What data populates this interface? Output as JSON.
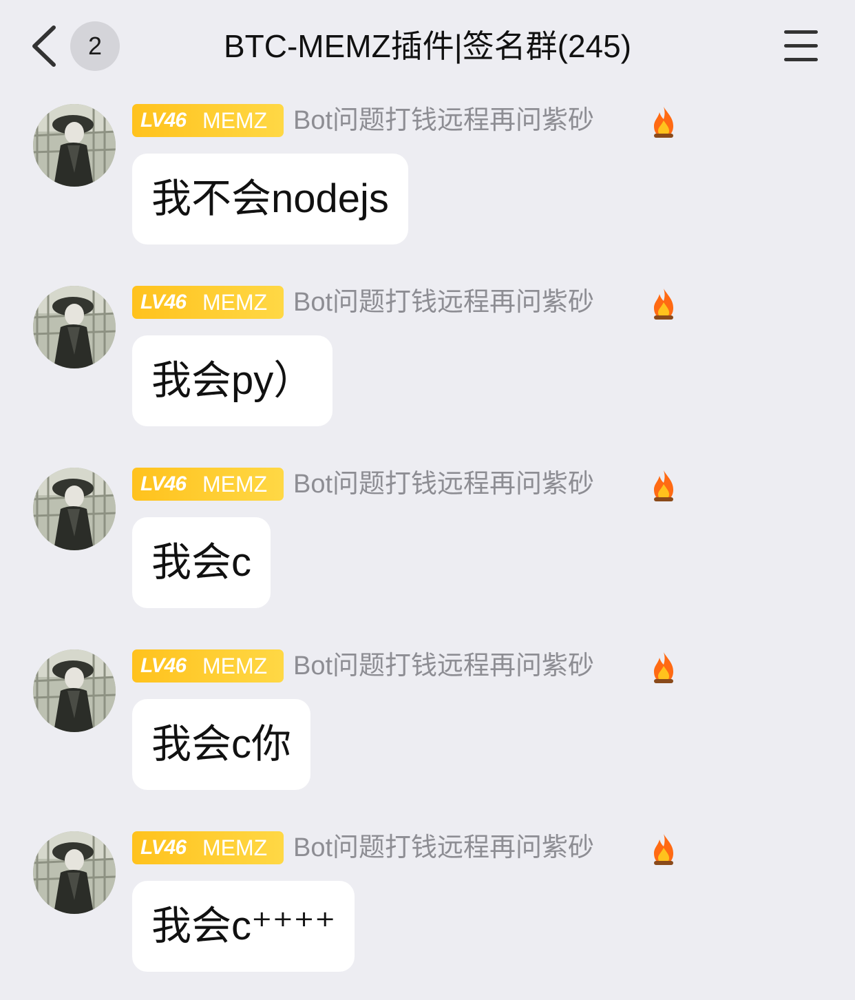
{
  "header": {
    "back_icon": "chevron-left-icon",
    "unread_count": "2",
    "title": "BTC-MEMZ插件|签名群(245)",
    "menu_icon": "hamburger-menu-icon"
  },
  "colors": {
    "background": "#ededf2",
    "bubble": "#ffffff",
    "badge_yellow": "#ffc21d",
    "name_gray": "#8d8d93"
  },
  "messages": [
    {
      "level": "LV46",
      "tag": "MEMZ",
      "sender": "Bot问题打钱远程再问紫砂",
      "badge_icon": "flame-icon",
      "text": "我不会nodejs"
    },
    {
      "level": "LV46",
      "tag": "MEMZ",
      "sender": "Bot问题打钱远程再问紫砂",
      "badge_icon": "flame-icon",
      "text": "我会py）"
    },
    {
      "level": "LV46",
      "tag": "MEMZ",
      "sender": "Bot问题打钱远程再问紫砂",
      "badge_icon": "flame-icon",
      "text": "我会c"
    },
    {
      "level": "LV46",
      "tag": "MEMZ",
      "sender": "Bot问题打钱远程再问紫砂",
      "badge_icon": "flame-icon",
      "text": "我会c你"
    },
    {
      "level": "LV46",
      "tag": "MEMZ",
      "sender": "Bot问题打钱远程再问紫砂",
      "badge_icon": "flame-icon",
      "text": "我会c⁺⁺⁺⁺"
    }
  ]
}
